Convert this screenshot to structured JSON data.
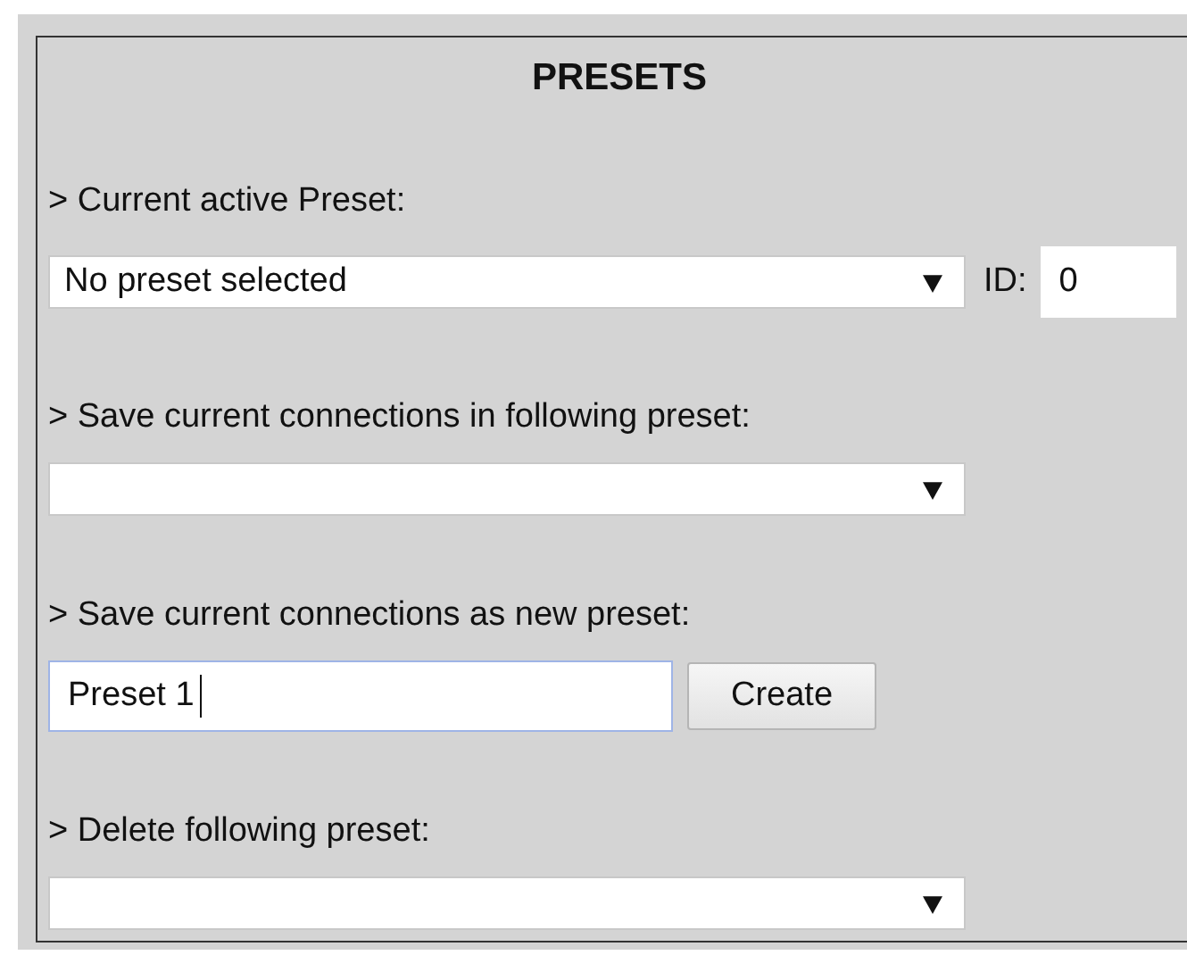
{
  "title": "PRESETS",
  "sections": [
    {
      "kind": "select-id",
      "label": "> Current active Preset:",
      "value": "No preset selected",
      "id_label": "ID:",
      "id_value": "0"
    },
    {
      "kind": "select",
      "label": "> Save current connections in following preset:"
    },
    {
      "kind": "create",
      "label": "> Save current connections as new preset:",
      "value": "Preset 1",
      "focused": true,
      "button": "Create"
    },
    {
      "kind": "select",
      "label": "> Delete following preset:"
    }
  ]
}
